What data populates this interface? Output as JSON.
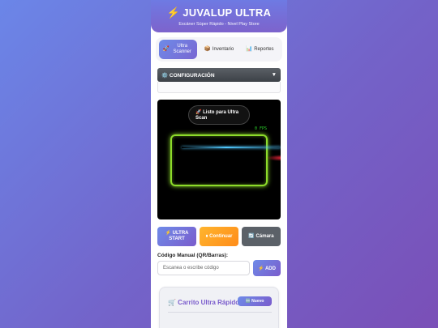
{
  "header": {
    "bolt_icon": "⚡",
    "title": "JUVALUP ULTRA",
    "subtitle": "Escáner Súper Rápido - Nivel Play Store"
  },
  "tabs": [
    {
      "icon": "🚀",
      "label": "Ultra Scanner",
      "active": true
    },
    {
      "icon": "📦",
      "label": "Inventario",
      "active": false
    },
    {
      "icon": "📊",
      "label": "Reportes",
      "active": false
    }
  ],
  "config": {
    "icon": "⚙️",
    "label": "CONFIGURACIÓN",
    "arrow": "▼"
  },
  "scanner": {
    "status": "🚀 Listo para Ultra Scan",
    "fps": "0 FPS",
    "frame_color": "#8ddc2a"
  },
  "actions": {
    "start": "⚡ ULTRA START",
    "continue": "⏸ Continuar",
    "camera": "🔄 Cámara"
  },
  "manual": {
    "label": "Código Manual (QR/Barras):",
    "placeholder": "Escanea o escribe código",
    "add": "⚡ ADD"
  },
  "cart": {
    "title": "🛒 Carrito Ultra Rápido",
    "new_button": "🆕 Nuevo"
  },
  "colors": {
    "accent": "#7a5ccc",
    "orange": "#ff9a1f",
    "gray_button": "#5b6168"
  }
}
